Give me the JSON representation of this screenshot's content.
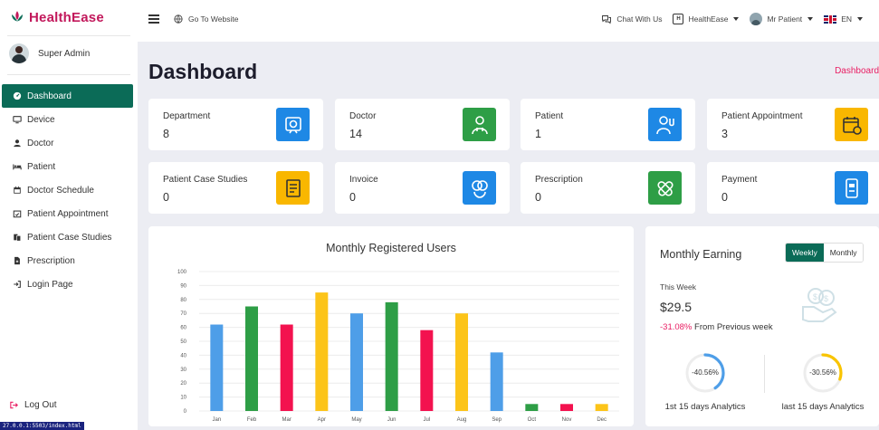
{
  "brand": {
    "name": "HealthEase",
    "color": "#c2185b"
  },
  "user": {
    "name": "Super Admin"
  },
  "sidebar": {
    "items": [
      {
        "label": "Dashboard",
        "icon": "dashboard-icon",
        "active": true
      },
      {
        "label": "Device",
        "icon": "monitor-icon"
      },
      {
        "label": "Doctor",
        "icon": "user-icon"
      },
      {
        "label": "Patient",
        "icon": "bed-icon"
      },
      {
        "label": "Doctor Schedule",
        "icon": "calendar-icon"
      },
      {
        "label": "Patient Appointment",
        "icon": "calendar-check-icon"
      },
      {
        "label": "Patient Case Studies",
        "icon": "files-icon"
      },
      {
        "label": "Prescription",
        "icon": "file-medical-icon"
      },
      {
        "label": "Login Page",
        "icon": "sign-in-icon"
      }
    ],
    "logout": "Log Out"
  },
  "status_url": "27.0.0.1:5503/index.html",
  "header": {
    "go_to_website": "Go To Website",
    "chat": "Chat With Us",
    "org": "HealthEase",
    "patient": "Mr Patient",
    "lang": "EN"
  },
  "page": {
    "title": "Dashboard",
    "breadcrumb": "Dashboard"
  },
  "cards": [
    {
      "label": "Department",
      "value": "8",
      "color": "#1e88e5",
      "icon": "department-icon"
    },
    {
      "label": "Doctor",
      "value": "14",
      "color": "#2e9e46",
      "icon": "doctor-icon"
    },
    {
      "label": "Patient",
      "value": "1",
      "color": "#1e88e5",
      "icon": "patient-icon"
    },
    {
      "label": "Patient Appointment",
      "value": "3",
      "color": "#f9b700",
      "icon": "appointment-icon"
    },
    {
      "label": "Patient Case Studies",
      "value": "0",
      "color": "#f9b700",
      "icon": "case-study-icon"
    },
    {
      "label": "Invoice",
      "value": "0",
      "color": "#1e88e5",
      "icon": "invoice-icon"
    },
    {
      "label": "Prescription",
      "value": "0",
      "color": "#2e9e46",
      "icon": "pill-icon"
    },
    {
      "label": "Payment",
      "value": "0",
      "color": "#1e88e5",
      "icon": "payment-icon"
    }
  ],
  "chart_data": {
    "type": "bar",
    "title": "Monthly Registered Users",
    "categories": [
      "Jan",
      "Feb",
      "Mar",
      "Apr",
      "May",
      "Jun",
      "Jul",
      "Aug",
      "Sep",
      "Oct",
      "Nov",
      "Dec"
    ],
    "values": [
      62,
      75,
      62,
      85,
      70,
      78,
      58,
      70,
      42,
      5,
      5,
      5
    ],
    "colors": [
      "#4e9ee8",
      "#2e9e46",
      "#f3124f",
      "#fcc419",
      "#4e9ee8",
      "#2e9e46",
      "#f3124f",
      "#fcc419",
      "#4e9ee8",
      "#2e9e46",
      "#f3124f",
      "#fcc419"
    ],
    "ylim": [
      0,
      100
    ],
    "yticks": [
      0,
      10,
      20,
      30,
      40,
      50,
      60,
      70,
      80,
      90,
      100
    ],
    "grid": true,
    "xlabel": "",
    "ylabel": ""
  },
  "earning": {
    "title": "Monthly Earning",
    "tabs": [
      "Weekly",
      "Monthly"
    ],
    "period": "This Week",
    "amount": "$29.5",
    "change": "-31.08%",
    "change_text": "From Previous week",
    "rings": [
      {
        "label": "-40.56%",
        "value": 40.56,
        "color": "#4e9ee8",
        "caption": "1st 15 days Analytics"
      },
      {
        "label": "-30.56%",
        "value": 30.56,
        "color": "#f9c400",
        "caption": "last 15 days Analytics"
      }
    ]
  }
}
